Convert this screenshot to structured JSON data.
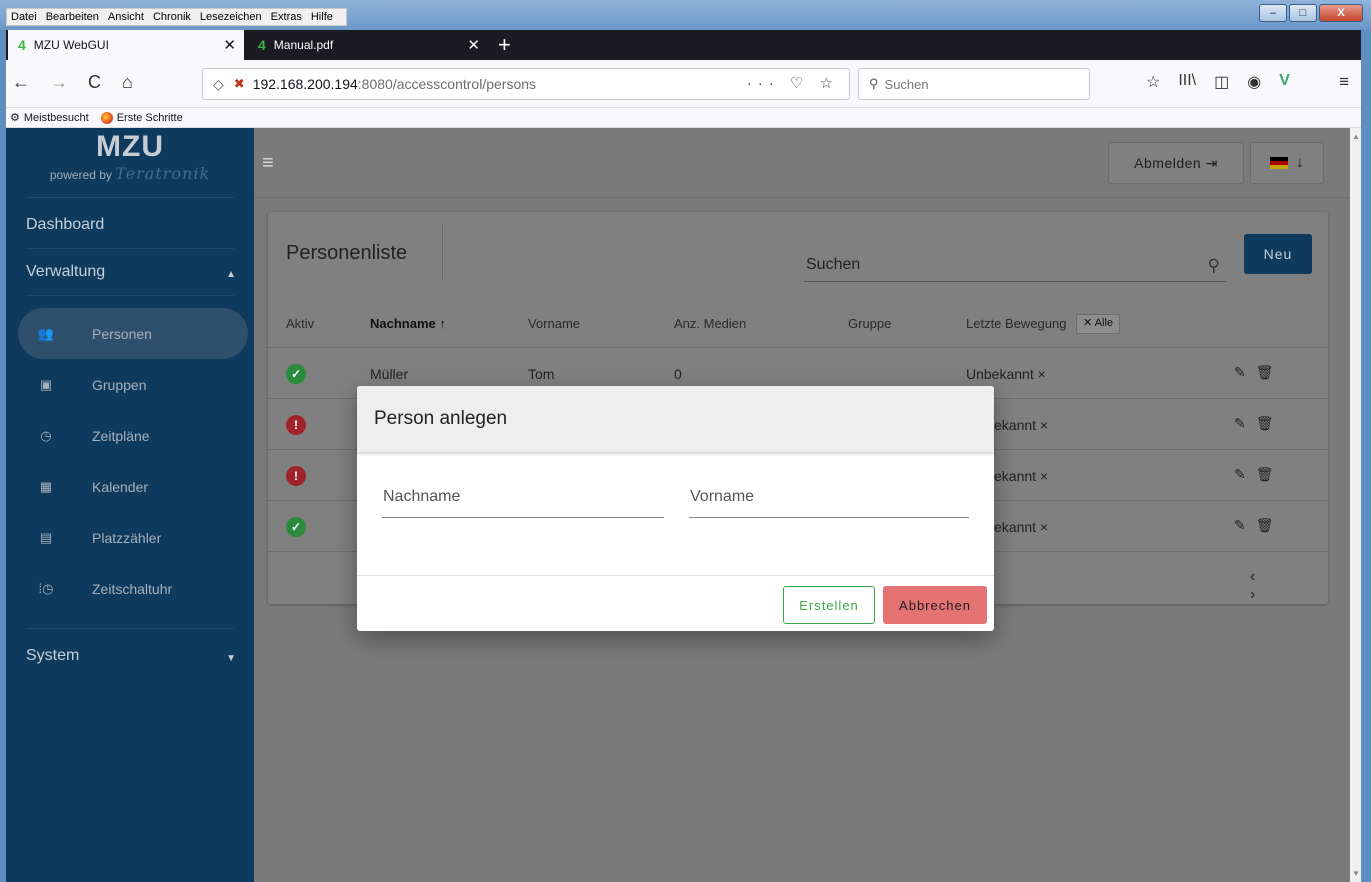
{
  "os": {
    "menu": [
      "Datei",
      "Bearbeiten",
      "Ansicht",
      "Chronik",
      "Lesezeichen",
      "Extras",
      "Hilfe"
    ],
    "min": "–",
    "max": "□",
    "close": "X"
  },
  "tabs": [
    {
      "icon": "4",
      "title": "MZU WebGUI",
      "close": "✕"
    },
    {
      "icon": "4",
      "title": "Manual.pdf",
      "close": "✕"
    }
  ],
  "newtab": "+",
  "nav": {
    "back": "←",
    "forward": "→",
    "reload": "C",
    "home": "⌂",
    "url_host": "192.168.200.194",
    "url_path": ":8080/accesscontrol/persons",
    "url_actions": "··· ♡ ☆",
    "search_placeholder": "Suchen",
    "search_icon": "⚲",
    "toolbar": [
      "☆",
      "III\\",
      "◫",
      "◉",
      "V"
    ],
    "menu": "≡"
  },
  "bookmarks": [
    {
      "icon": "⚙",
      "label": "Meistbesucht"
    },
    {
      "label": "Erste Schritte"
    }
  ],
  "sidebar": {
    "logo": "MZU",
    "logo_sub": "powered by",
    "logo_brand": "Teratronik",
    "dashboard": "Dashboard",
    "section1": {
      "label": "Verwaltung",
      "caret": "▲"
    },
    "items": [
      {
        "icon": "👥",
        "label": "Personen"
      },
      {
        "icon": "▣",
        "label": "Gruppen"
      },
      {
        "icon": "◷",
        "label": "Zeitpläne"
      },
      {
        "icon": "▦",
        "label": "Kalender"
      },
      {
        "icon": "▤",
        "label": "Platzzähler"
      },
      {
        "icon": "⁞◷",
        "label": "Zeitschaltuhr"
      }
    ],
    "section2": {
      "label": "System",
      "caret": "▼"
    }
  },
  "header": {
    "menu_icon": "≡",
    "logout": "Abmelden ⇥",
    "lang_arrow": "↓"
  },
  "card": {
    "title": "Personenliste",
    "search_placeholder": "Suchen",
    "search_icon": "⚲",
    "new_label": "Neu",
    "columns": {
      "active": "Aktiv",
      "lastname": "Nachname ↑",
      "firstname": "Vorname",
      "media": "Anz. Medien",
      "group": "Gruppe",
      "last_move": "Letzte Bewegung"
    },
    "all_chip": "✕ Alle",
    "rows": [
      {
        "status": "✓",
        "lastname": "Müller",
        "firstname": "Tom",
        "media": "0",
        "last_move": "Unbekannt ×"
      },
      {
        "status": "!",
        "lastname": "",
        "firstname": "",
        "media": "",
        "last_move": "ekannt ×"
      },
      {
        "status": "!",
        "lastname": "",
        "firstname": "",
        "media": "",
        "last_move": "ekannt ×"
      },
      {
        "status": "✓",
        "lastname": "",
        "firstname": "",
        "media": "",
        "last_move": "ekannt ×"
      }
    ],
    "row_actions": "✎🗑",
    "pager": "‹ ›"
  },
  "modal": {
    "title": "Person anlegen",
    "lastname_placeholder": "Nachname",
    "firstname_placeholder": "Vorname",
    "create": "Erstellen",
    "cancel": "Abbrechen"
  }
}
